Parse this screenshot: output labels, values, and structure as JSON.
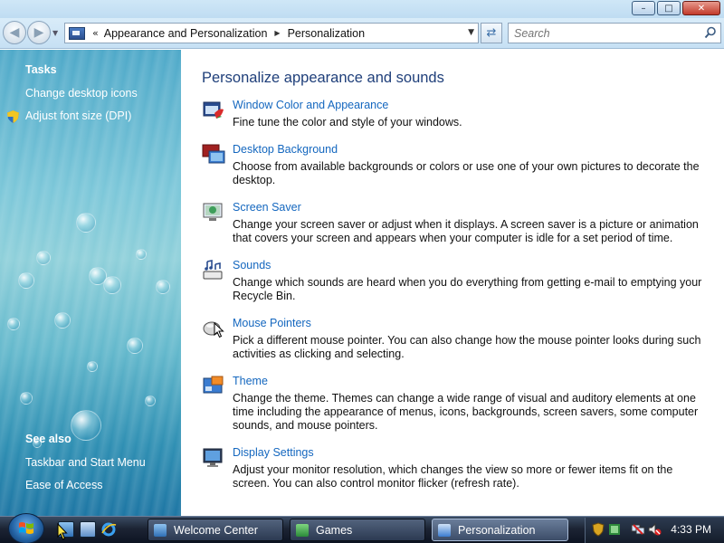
{
  "window": {
    "controls": {
      "minimize": "–",
      "maximize": "□",
      "close": "✕"
    }
  },
  "navbar": {
    "back_icon": "back-arrow-icon",
    "forward_icon": "forward-arrow-icon",
    "address_prefix": "«",
    "breadcrumbs": [
      "Appearance and Personalization",
      "Personalization"
    ],
    "search_placeholder": "Search"
  },
  "sidebar": {
    "tasks_heading": "Tasks",
    "tasks": [
      "Change desktop icons",
      "Adjust font size (DPI)"
    ],
    "see_also_heading": "See also",
    "see_also": [
      "Taskbar and Start Menu",
      "Ease of Access"
    ]
  },
  "main": {
    "title": "Personalize appearance and sounds",
    "items": [
      {
        "icon": "window-color-icon",
        "label": "Window Color and Appearance",
        "desc": "Fine tune the color and style of your windows."
      },
      {
        "icon": "desktop-background-icon",
        "label": "Desktop Background",
        "desc": "Choose from available backgrounds or colors or use one of your own pictures to decorate the desktop."
      },
      {
        "icon": "screen-saver-icon",
        "label": "Screen Saver",
        "desc": "Change your screen saver or adjust when it displays. A screen saver is a picture or animation that covers your screen and appears when your computer is idle for a set period of time."
      },
      {
        "icon": "sounds-icon",
        "label": "Sounds",
        "desc": "Change which sounds are heard when you do everything from getting e-mail to emptying your Recycle Bin."
      },
      {
        "icon": "mouse-pointers-icon",
        "label": "Mouse Pointers",
        "desc": "Pick a different mouse pointer. You can also change how the mouse pointer looks during such activities as clicking and selecting."
      },
      {
        "icon": "theme-icon",
        "label": "Theme",
        "desc": "Change the theme. Themes can change a wide range of visual and auditory elements at one time including the appearance of menus, icons, backgrounds, screen savers, some computer sounds, and mouse pointers."
      },
      {
        "icon": "display-settings-icon",
        "label": "Display Settings",
        "desc": "Adjust your monitor resolution, which changes the view so more or fewer items fit on the screen. You can also control monitor flicker (refresh rate)."
      }
    ]
  },
  "taskbar": {
    "buttons": [
      "Welcome Center",
      "Games",
      "Personalization"
    ],
    "active": "Personalization",
    "clock": "4:33 PM"
  },
  "colors": {
    "link": "#1467bf",
    "title": "#1f3f7a",
    "sidebar_top": "#4fa9c9",
    "sidebar_bottom": "#1e76a4",
    "taskbar": "#1c2434"
  }
}
